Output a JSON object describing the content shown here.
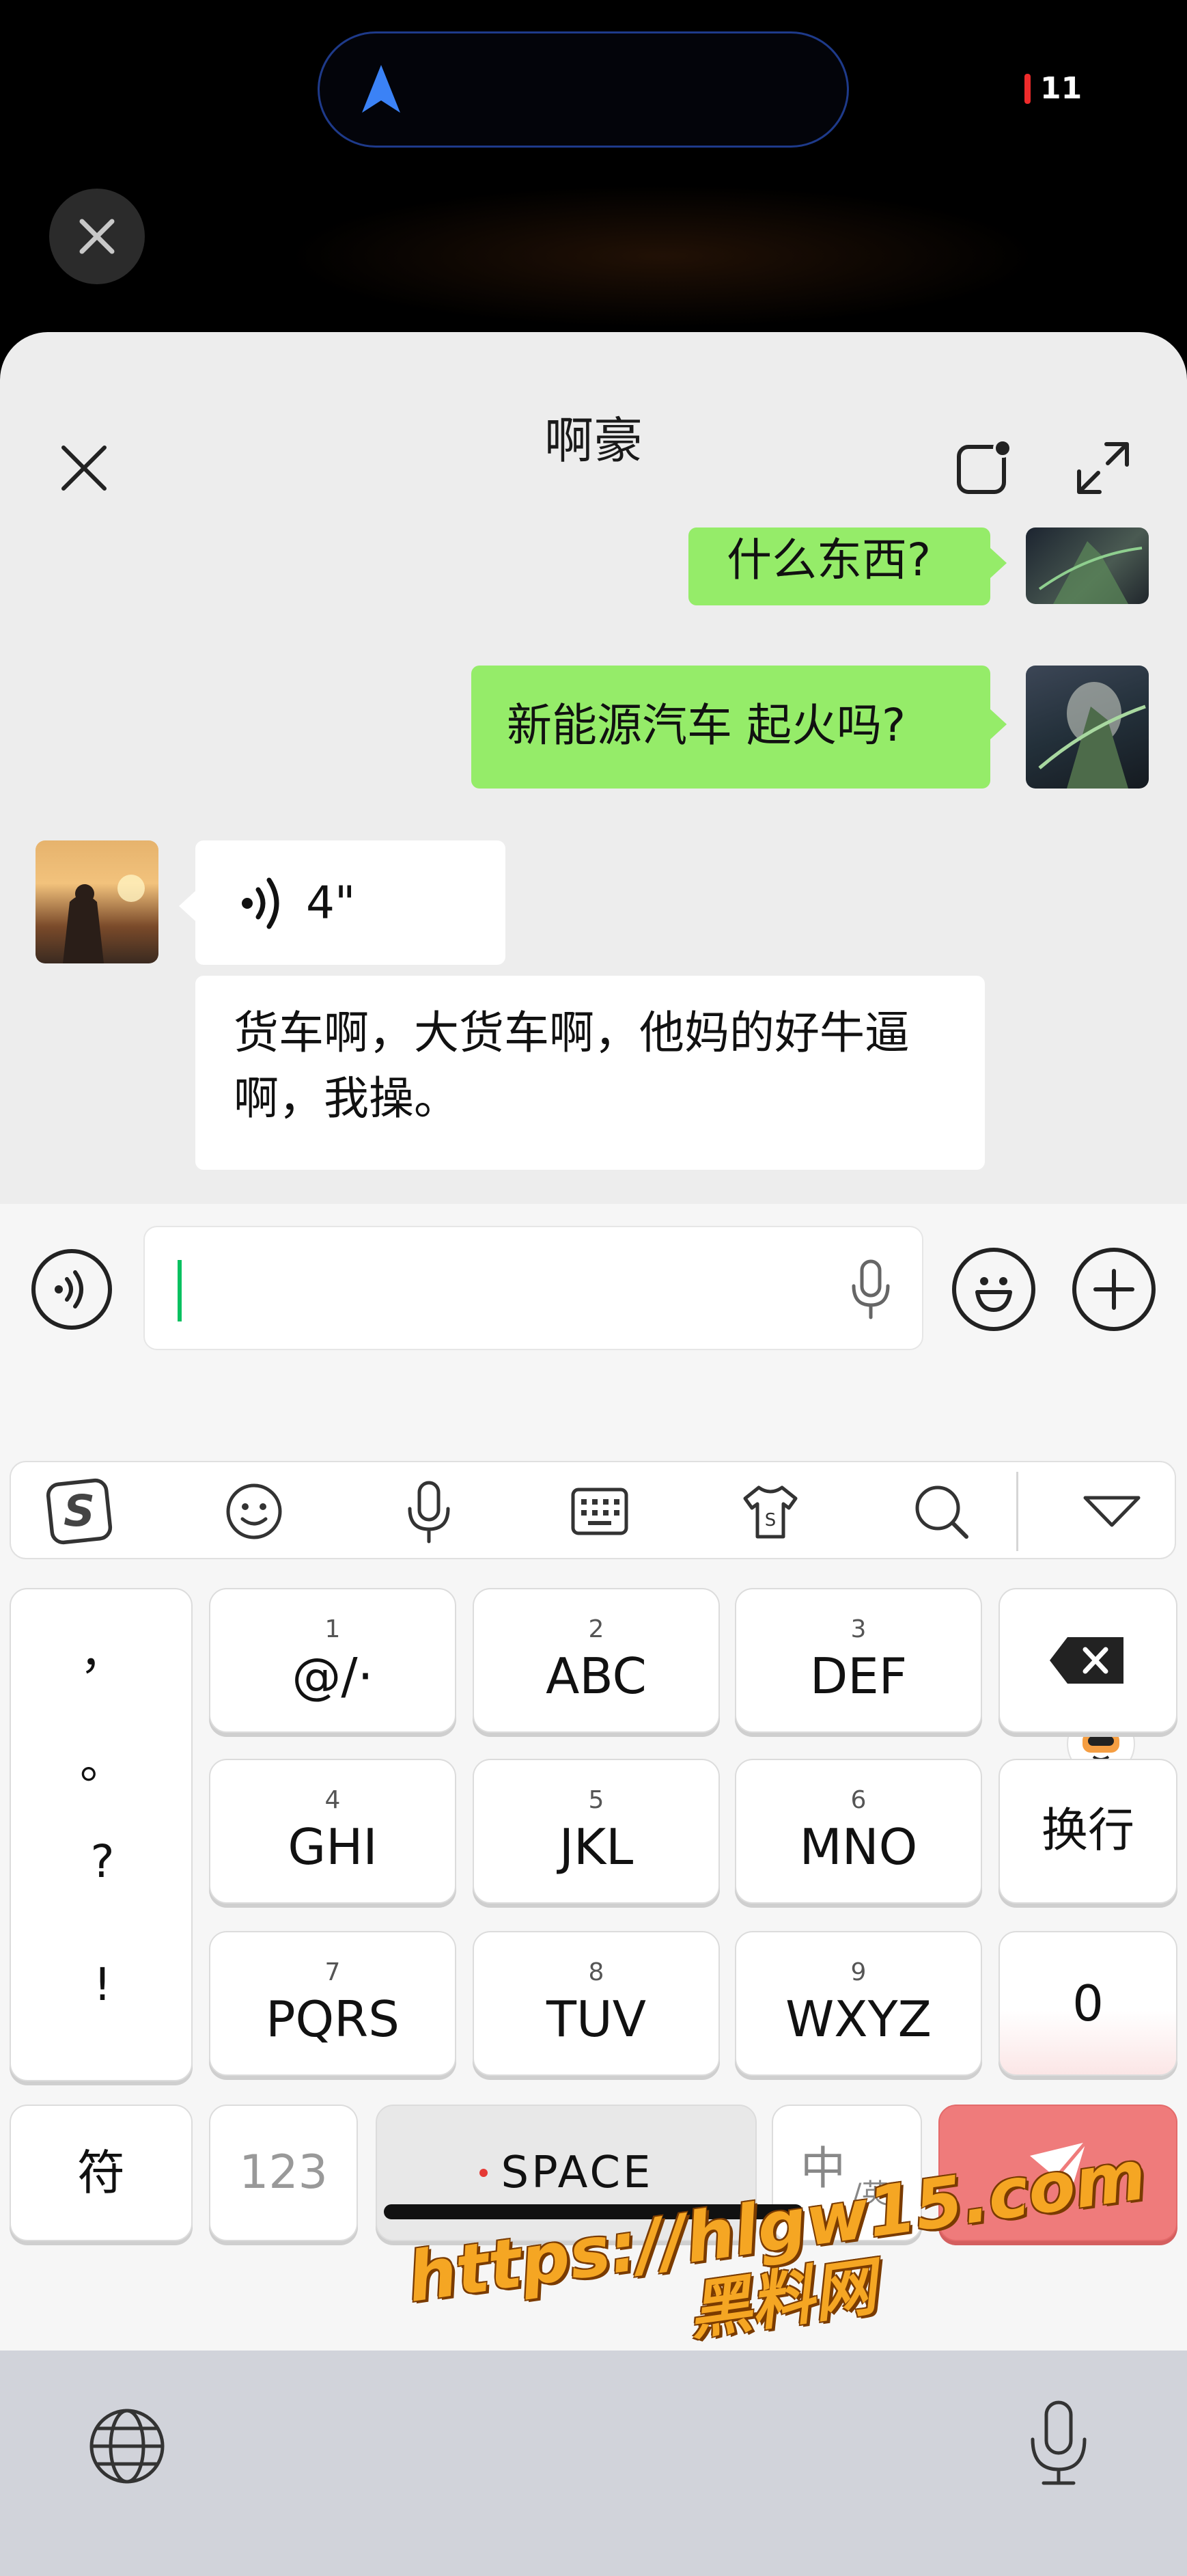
{
  "status_bar": {
    "battery_level": "11",
    "battery_color": "#ef2b2b",
    "nav_icon": "location-arrow-icon",
    "island_border_color": "#1e3a8a"
  },
  "overlay": {
    "close_icon": "close-icon"
  },
  "chat": {
    "title": "啊豪",
    "header_icons": [
      "close-icon",
      "minimize-window-icon",
      "expand-icon"
    ],
    "messages": [
      {
        "side": "right",
        "type": "text",
        "text": "什么东西?"
      },
      {
        "side": "right",
        "type": "text",
        "text": "新能源汽车 起火吗?"
      },
      {
        "side": "left",
        "type": "voice",
        "duration": "4\""
      },
      {
        "side": "left",
        "type": "text",
        "text": "货车啊，大货车啊，他妈的好牛逼啊，我操。"
      }
    ],
    "bubble_colors": {
      "sent": "#95ec69",
      "received": "#ffffff"
    }
  },
  "input_bar": {
    "voice_icon": "voice-mode-icon",
    "mic_icon": "microphone-icon",
    "emoji_icon": "emoji-icon",
    "plus_icon": "plus-icon",
    "caret_color": "#07c160"
  },
  "keyboard": {
    "toolbar_icons": [
      "sogou-logo-icon",
      "emoji-face-icon",
      "voice-input-icon",
      "keyboard-icon",
      "skin-icon",
      "search-icon",
      "collapse-icon"
    ],
    "punct": [
      "，",
      "。",
      "?",
      "!"
    ],
    "keys": [
      {
        "num": "1",
        "label": "@/·"
      },
      {
        "num": "2",
        "label": "ABC"
      },
      {
        "num": "3",
        "label": "DEF"
      },
      {
        "num": "4",
        "label": "GHI"
      },
      {
        "num": "5",
        "label": "JKL"
      },
      {
        "num": "6",
        "label": "MNO"
      },
      {
        "num": "7",
        "label": "PQRS"
      },
      {
        "num": "8",
        "label": "TUV"
      },
      {
        "num": "9",
        "label": "WXYZ"
      }
    ],
    "newline_label": "换行",
    "zero_label": "0",
    "symbol_label": "符",
    "numbers_label": "123",
    "space_label": "SPACE",
    "lang_main": "中",
    "lang_sub": "/英",
    "send_color": "#ef7b7b"
  },
  "system_bar": {
    "left_icon": "globe-icon",
    "right_icon": "microphone-icon"
  },
  "watermark": {
    "line1": "https://hlgw15.com",
    "line2": "黑料网"
  }
}
